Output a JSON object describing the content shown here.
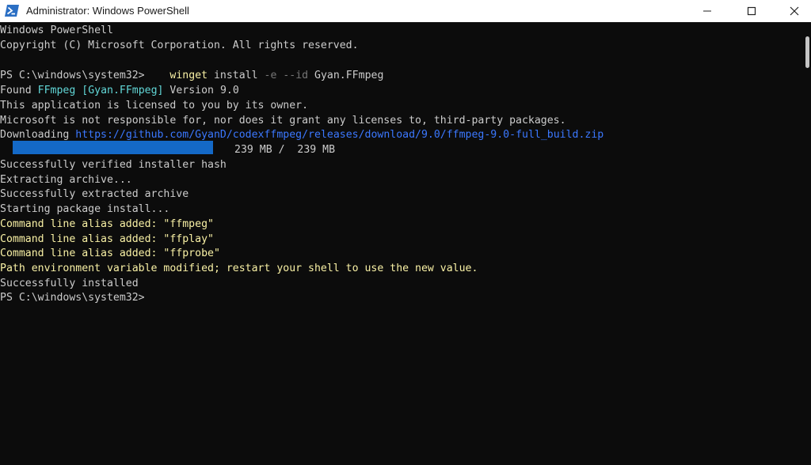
{
  "window": {
    "title": "Administrator: Windows PowerShell",
    "app_icon": "powershell-icon",
    "controls": [
      "minimize-icon",
      "maximize-icon",
      "close-icon"
    ]
  },
  "console": {
    "header_line1": "Windows PowerShell",
    "header_line2": "Copyright (C) Microsoft Corporation. All rights reserved.",
    "prompt1": "PS C:\\windows\\system32>",
    "cmd_winget": "winget",
    "cmd_install": "install",
    "cmd_flags": "-e --id",
    "cmd_id": "Gyan.FFmpeg",
    "found_prefix": "Found",
    "found_name": "FFmpeg",
    "found_id": "[Gyan.FFmpeg]",
    "found_version": "Version 9.0",
    "licensed": "This application is licensed to you by its owner.",
    "not_responsible": "Microsoft is not responsible for, nor does it grant any licenses to, third-party packages.",
    "downloading_label": "Downloading",
    "download_url": "https://github.com/GyanD/codexffmpeg/releases/download/9.0/ffmpeg-9.0-full_build.zip",
    "progress_text": "239 MB /  239 MB",
    "progress_fraction": 1.0,
    "verified": "Successfully verified installer hash",
    "extracting": "Extracting archive...",
    "extracted": "Successfully extracted archive",
    "starting": "Starting package install...",
    "alias1": "Command line alias added: \"ffmpeg\"",
    "alias2": "Command line alias added: \"ffplay\"",
    "alias3": "Command line alias added: \"ffprobe\"",
    "path_modified": "Path environment variable modified; restart your shell to use the new value.",
    "installed": "Successfully installed",
    "prompt2": "PS C:\\windows\\system32>"
  },
  "colors": {
    "background": "#0c0c0c",
    "text": "#cccccc",
    "command": "#f9f1a5",
    "package_name": "#61d6d6",
    "link": "#3b78ff",
    "progress": "#1469c7"
  }
}
